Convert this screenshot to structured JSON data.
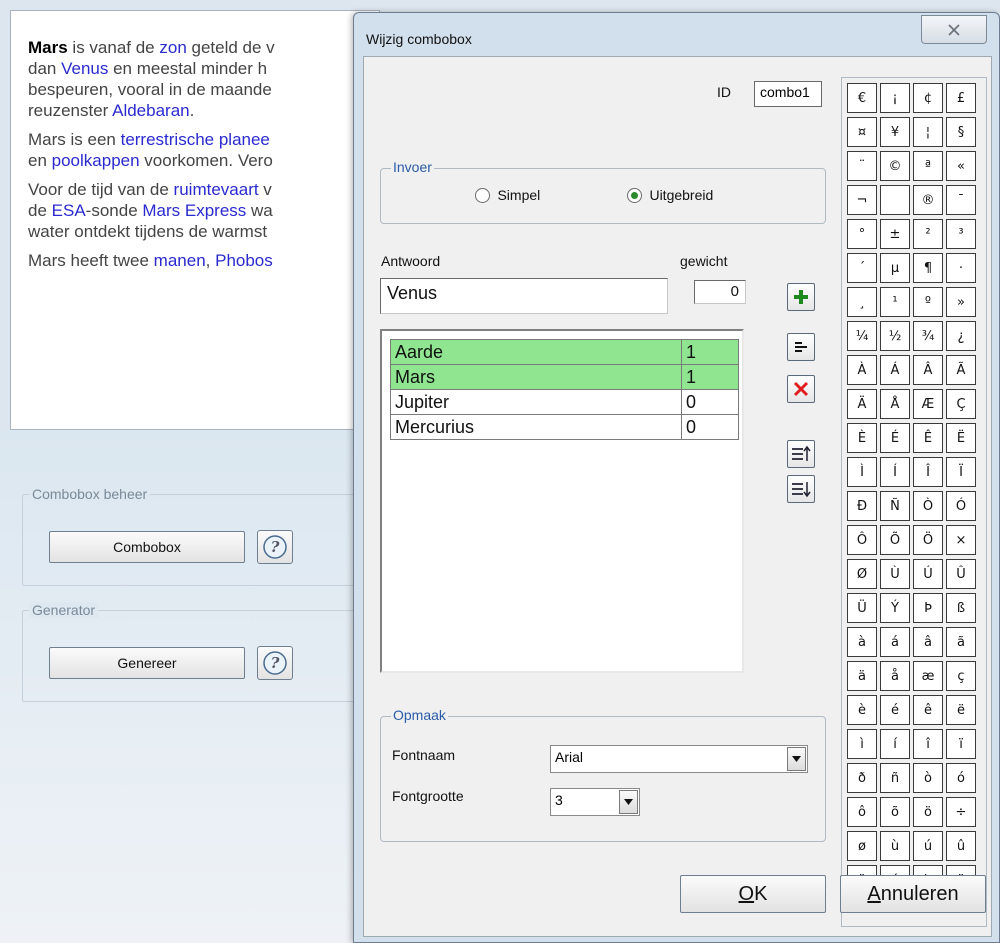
{
  "background": {
    "article": {
      "p1": [
        "Mars",
        " is vanaf de ",
        "zon",
        " geteld de v",
        "dan ",
        "Venus",
        " en meestal minder h",
        "bespeuren, vooral in de maande",
        "reuzenster ",
        "Aldebaran",
        "."
      ],
      "p2": [
        "Mars is een ",
        "terrestrische planee",
        "en ",
        "poolkappen",
        " voorkomen. Vero"
      ],
      "p3": [
        "Voor de tijd van de ",
        "ruimtevaart",
        " v",
        "de ",
        "ESA",
        "-sonde ",
        "Mars Express",
        " wa",
        "water ontdekt tijdens de warmst"
      ],
      "p4": [
        "Mars heeft twee ",
        "manen",
        ", ",
        "Phobos"
      ]
    },
    "group1": {
      "legend": "Combobox beheer",
      "button": "Combobox"
    },
    "group2": {
      "legend": "Generator",
      "button": "Genereer"
    }
  },
  "dialog": {
    "title": "Wijzig combobox",
    "id_label": "ID",
    "id_value": "combo1",
    "invoer": {
      "legend": "Invoer",
      "option_simple": "Simpel",
      "option_extended": "Uitgebreid",
      "selected": "Uitgebreid"
    },
    "answer_label": "Antwoord",
    "weight_label": "gewicht",
    "answer_value": "Venus",
    "weight_value": "0",
    "answers": [
      {
        "text": "Aarde",
        "weight": "1",
        "correct": true
      },
      {
        "text": "Mars",
        "weight": "1",
        "correct": true
      },
      {
        "text": "Jupiter",
        "weight": "0",
        "correct": false
      },
      {
        "text": "Mercurius",
        "weight": "0",
        "correct": false
      }
    ],
    "opmaak": {
      "legend": "Opmaak",
      "font_name_label": "Fontnaam",
      "font_name_value": "Arial",
      "font_size_label": "Fontgrootte",
      "font_size_value": "3"
    },
    "ok_label": "OK",
    "cancel_label": "Annuleren",
    "special_chars": [
      "€",
      "¡",
      "¢",
      "£",
      "¤",
      "¥",
      "¦",
      "§",
      "¨",
      "©",
      "ª",
      "«",
      "¬",
      "­",
      "®",
      "¯",
      "°",
      "±",
      "²",
      "³",
      "´",
      "µ",
      "¶",
      "·",
      "¸",
      "¹",
      "º",
      "»",
      "¼",
      "½",
      "¾",
      "¿",
      "À",
      "Á",
      "Â",
      "Ã",
      "Ä",
      "Å",
      "Æ",
      "Ç",
      "È",
      "É",
      "Ê",
      "Ë",
      "Ì",
      "Í",
      "Î",
      "Ï",
      "Ð",
      "Ñ",
      "Ò",
      "Ó",
      "Ô",
      "Õ",
      "Ö",
      "×",
      "Ø",
      "Ù",
      "Ú",
      "Û",
      "Ü",
      "Ý",
      "Þ",
      "ß",
      "à",
      "á",
      "â",
      "ã",
      "ä",
      "å",
      "æ",
      "ç",
      "è",
      "é",
      "ê",
      "ë",
      "ì",
      "í",
      "î",
      "ï",
      "ð",
      "ñ",
      "ò",
      "ó",
      "ô",
      "õ",
      "ö",
      "÷",
      "ø",
      "ù",
      "ú",
      "û",
      "ü",
      "ý",
      "þ",
      "ÿ"
    ],
    "colors": {
      "correct_row": "#90e690",
      "legend_text": "#2a5ca8",
      "add_icon": "#1e8a1e",
      "delete_icon": "#e02020"
    }
  }
}
